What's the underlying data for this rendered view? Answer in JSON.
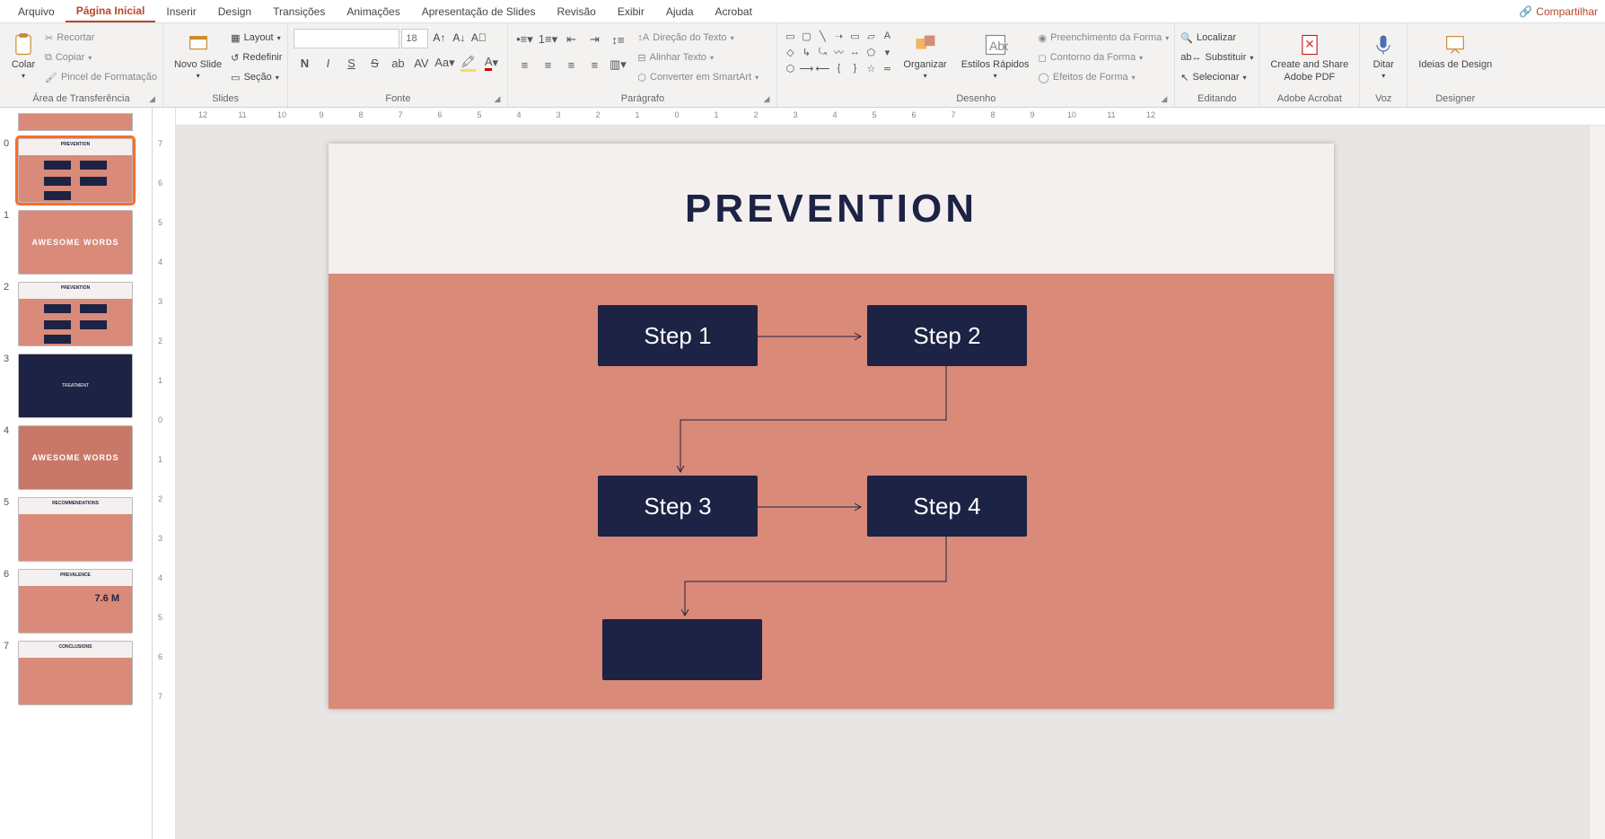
{
  "menu": {
    "tabs": [
      "Arquivo",
      "Página Inicial",
      "Inserir",
      "Design",
      "Transições",
      "Animações",
      "Apresentação de Slides",
      "Revisão",
      "Exibir",
      "Ajuda",
      "Acrobat"
    ],
    "active_index": 1,
    "share": "Compartilhar"
  },
  "ribbon": {
    "clipboard": {
      "paste": "Colar",
      "cut": "Recortar",
      "copy": "Copiar",
      "format_painter": "Pincel de Formatação",
      "label": "Área de Transferência"
    },
    "slides": {
      "new_slide": "Novo Slide",
      "layout": "Layout",
      "reset": "Redefinir",
      "section": "Seção",
      "label": "Slides"
    },
    "font": {
      "name": "",
      "size": "18",
      "bold": "N",
      "italic": "I",
      "underline": "S",
      "strike": "S",
      "shadow": "S",
      "label": "Fonte"
    },
    "paragraph": {
      "text_direction": "Direção do Texto",
      "align_text": "Alinhar Texto",
      "convert_smartart": "Converter em SmartArt",
      "label": "Parágrafo"
    },
    "drawing": {
      "arrange": "Organizar",
      "quick_styles": "Estilos Rápidos",
      "shape_fill": "Preenchimento da Forma",
      "shape_outline": "Contorno da Forma",
      "shape_effects": "Efeitos de Forma",
      "label": "Desenho"
    },
    "editing": {
      "find": "Localizar",
      "replace": "Substituir",
      "select": "Selecionar",
      "label": "Editando"
    },
    "adobe": {
      "create_share_pdf1": "Create and Share",
      "create_share_pdf2": "Adobe PDF",
      "label": "Adobe Acrobat"
    },
    "voice": {
      "dictate": "Ditar",
      "label": "Voz"
    },
    "designer": {
      "ideas": "Ideias de Design",
      "label": "Designer"
    }
  },
  "ruler_h": [
    "12",
    "11",
    "10",
    "9",
    "8",
    "7",
    "6",
    "5",
    "4",
    "3",
    "2",
    "1",
    "0",
    "1",
    "2",
    "3",
    "4",
    "5",
    "6",
    "7",
    "8",
    "9",
    "10",
    "11",
    "12"
  ],
  "ruler_v": [
    "7",
    "6",
    "5",
    "4",
    "3",
    "2",
    "1",
    "0",
    "1",
    "2",
    "3",
    "4",
    "5",
    "6",
    "7"
  ],
  "thumbnails": [
    {
      "n": "0",
      "title": "PREVENTION",
      "sel": true,
      "style": "flow"
    },
    {
      "n": "1",
      "title": "AWESOME WORDS",
      "style": "words"
    },
    {
      "n": "2",
      "title": "PREVENTION",
      "style": "flow"
    },
    {
      "n": "3",
      "title": "TREATMENT",
      "style": "dark"
    },
    {
      "n": "4",
      "title": "AWESOME WORDS",
      "style": "photo"
    },
    {
      "n": "5",
      "title": "RECOMMENDATIONS",
      "style": "recs"
    },
    {
      "n": "6",
      "title": "7.6 M",
      "style": "prev"
    },
    {
      "n": "7",
      "title": "CONCLUSIONS",
      "style": "concl"
    }
  ],
  "slide": {
    "title": "PREVENTION",
    "steps": [
      "Step 1",
      "Step 2",
      "Step 3",
      "Step 4",
      ""
    ]
  }
}
